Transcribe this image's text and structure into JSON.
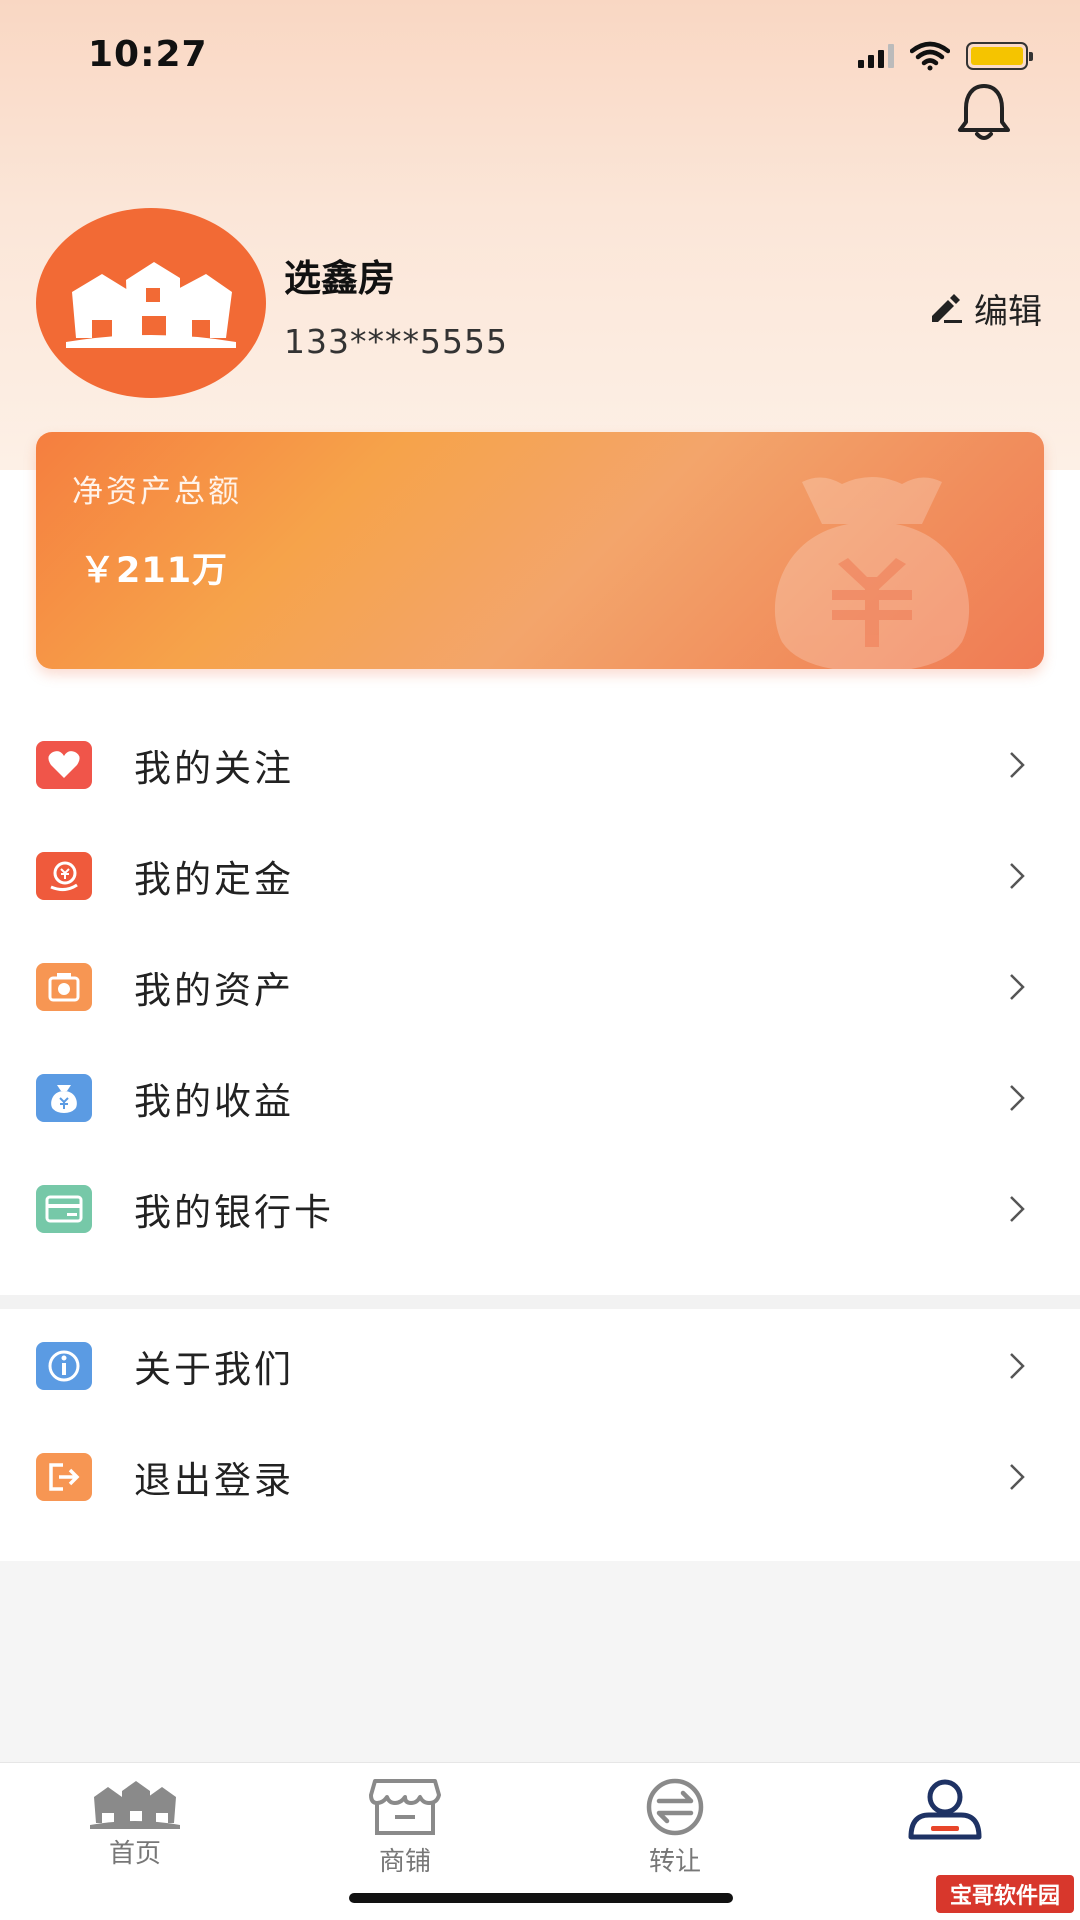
{
  "status_bar": {
    "time": "10:27"
  },
  "profile": {
    "name": "选鑫房",
    "phone": "133****5555",
    "edit_label": "编辑"
  },
  "asset_card": {
    "label": "净资产总额",
    "value": "￥211万"
  },
  "menu": [
    {
      "label": "我的关注",
      "icon": "heart-icon",
      "color": "#f0554a"
    },
    {
      "label": "我的定金",
      "icon": "deposit-icon",
      "color": "#ef5a3c"
    },
    {
      "label": "我的资产",
      "icon": "asset-icon",
      "color": "#f79653"
    },
    {
      "label": "我的收益",
      "icon": "moneybag-icon",
      "color": "#5b9be3"
    },
    {
      "label": "我的银行卡",
      "icon": "bankcard-icon",
      "color": "#76c8a8"
    }
  ],
  "menu2": [
    {
      "label": "关于我们",
      "icon": "info-icon",
      "color": "#5b9be3"
    },
    {
      "label": "退出登录",
      "icon": "logout-icon",
      "color": "#f79653"
    }
  ],
  "tabs": [
    {
      "label": "首页",
      "icon": "home-icon"
    },
    {
      "label": "商铺",
      "icon": "shop-icon"
    },
    {
      "label": "转让",
      "icon": "transfer-icon"
    },
    {
      "label": "",
      "icon": "profile-icon",
      "active": true
    }
  ],
  "watermark": "宝哥软件园",
  "colors": {
    "accent": "#f26a35",
    "card_start": "#f57e3f",
    "card_end": "#f07b54"
  }
}
